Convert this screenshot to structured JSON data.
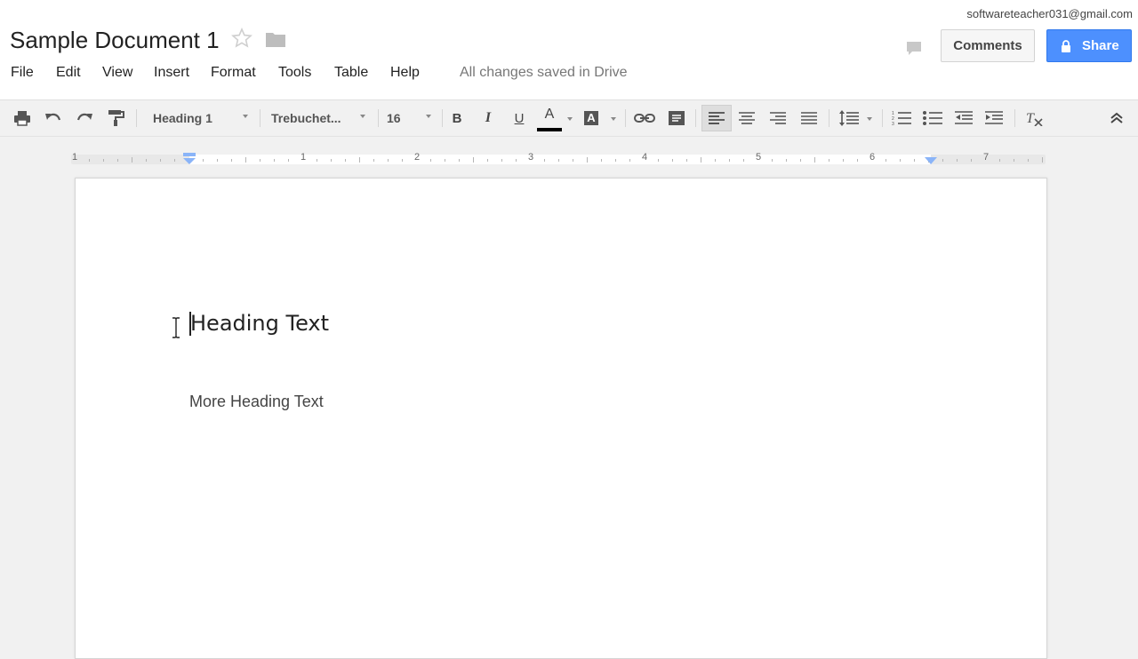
{
  "header": {
    "doc_title": "Sample Document 1",
    "save_status": "All changes saved in Drive",
    "user_email": "softwareteacher031@gmail.com",
    "comments_label": "Comments",
    "share_label": "Share",
    "accent_color": "#4d90fe",
    "icons": [
      "star-icon",
      "folder-icon",
      "chat-icon",
      "lock-icon"
    ]
  },
  "menu": {
    "items": [
      "File",
      "Edit",
      "View",
      "Insert",
      "Format",
      "Tools",
      "Table",
      "Help"
    ]
  },
  "toolbar": {
    "style": "Heading 1",
    "font": "Trebuchet...",
    "font_size": "16",
    "bold": "B",
    "italic": "I",
    "underline": "U",
    "text_color_glyph": "A",
    "highlight_glyph": "A",
    "text_color": "#000000",
    "alignment_selected": "left",
    "icons": [
      "print-icon",
      "undo-icon",
      "redo-icon",
      "paint-format-icon",
      "link-icon",
      "comment-icon",
      "align-left-icon",
      "align-center-icon",
      "align-right-icon",
      "align-justify-icon",
      "line-spacing-icon",
      "numbered-list-icon",
      "bulleted-list-icon",
      "decrease-indent-icon",
      "increase-indent-icon",
      "clear-formatting-icon",
      "collapse-icon"
    ]
  },
  "ruler": {
    "numbers": [
      "1",
      "1",
      "2",
      "3",
      "4",
      "5",
      "6",
      "7"
    ]
  },
  "document": {
    "heading": "Heading Text",
    "subheading": "More Heading Text"
  }
}
